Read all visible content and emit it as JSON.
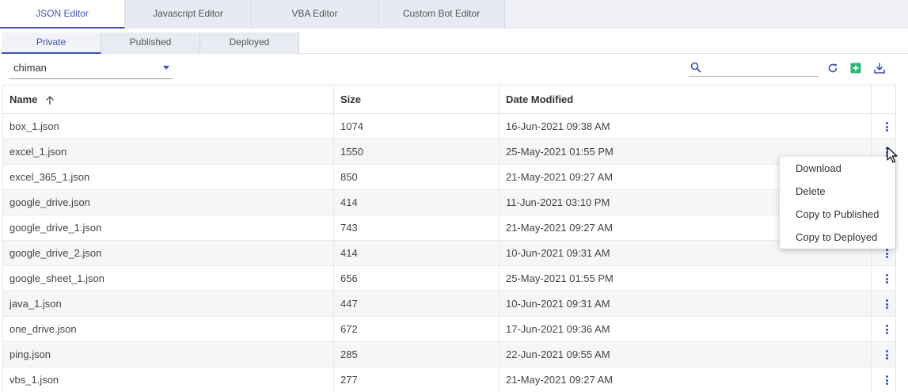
{
  "top_tabs": [
    {
      "label": "JSON Editor",
      "active": true
    },
    {
      "label": "Javascript Editor",
      "active": false
    },
    {
      "label": "VBA Editor",
      "active": false
    },
    {
      "label": "Custom Bot Editor",
      "active": false
    }
  ],
  "sub_tabs": [
    {
      "label": "Private",
      "active": true
    },
    {
      "label": "Published",
      "active": false
    },
    {
      "label": "Deployed",
      "active": false
    }
  ],
  "toolbar": {
    "user_select_value": "chiman",
    "search_value": "",
    "search_placeholder": "",
    "icons": [
      "search-icon",
      "refresh-icon",
      "add-icon",
      "download-icon"
    ]
  },
  "table": {
    "headers": {
      "name": "Name",
      "size": "Size",
      "date": "Date Modified"
    },
    "sort": {
      "column": "Name",
      "direction": "ascending"
    },
    "rows": [
      {
        "name": "box_1.json",
        "size": "1074",
        "date": "16-Jun-2021 09:38 AM"
      },
      {
        "name": "excel_1.json",
        "size": "1550",
        "date": "25-May-2021 01:55 PM"
      },
      {
        "name": "excel_365_1.json",
        "size": "850",
        "date": "21-May-2021 09:27 AM"
      },
      {
        "name": "google_drive.json",
        "size": "414",
        "date": "11-Jun-2021 03:10 PM"
      },
      {
        "name": "google_drive_1.json",
        "size": "743",
        "date": "21-May-2021 09:27 AM"
      },
      {
        "name": "google_drive_2.json",
        "size": "414",
        "date": "10-Jun-2021 09:31 AM"
      },
      {
        "name": "google_sheet_1.json",
        "size": "656",
        "date": "25-May-2021 01:55 PM"
      },
      {
        "name": "java_1.json",
        "size": "447",
        "date": "10-Jun-2021 09:31 AM"
      },
      {
        "name": "one_drive.json",
        "size": "672",
        "date": "17-Jun-2021 09:36 AM"
      },
      {
        "name": "ping.json",
        "size": "285",
        "date": "22-Jun-2021 09:55 AM"
      },
      {
        "name": "vbs_1.json",
        "size": "277",
        "date": "21-May-2021 09:27 AM"
      }
    ]
  },
  "context_menu": {
    "items": [
      "Download",
      "Delete",
      "Copy to Published",
      "Copy to Deployed"
    ]
  },
  "colors": {
    "accent": "#3f51b5",
    "add_green": "#2eb872",
    "refresh_blue": "#3f51b5"
  }
}
